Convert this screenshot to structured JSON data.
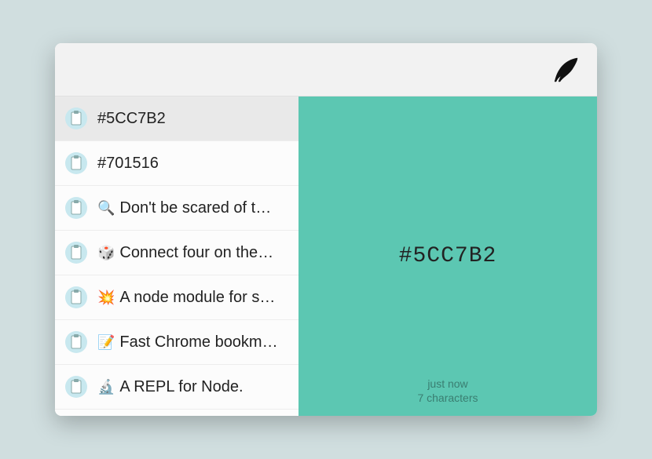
{
  "items": [
    {
      "emoji": "",
      "label": "#5CC7B2",
      "selected": true
    },
    {
      "emoji": "",
      "label": "#701516",
      "selected": false
    },
    {
      "emoji": "🔍",
      "label": "Don't be scared of t…",
      "selected": false
    },
    {
      "emoji": "🎲",
      "label": "Connect four on the…",
      "selected": false
    },
    {
      "emoji": "💥",
      "label": "A node module for s…",
      "selected": false
    },
    {
      "emoji": "📝",
      "label": "Fast Chrome bookm…",
      "selected": false
    },
    {
      "emoji": "🔬",
      "label": "A REPL for Node.",
      "selected": false
    }
  ],
  "preview": {
    "content": "#5CC7B2",
    "background_color": "#5CC7B2",
    "meta_time": "just now",
    "meta_chars": "7 characters"
  }
}
